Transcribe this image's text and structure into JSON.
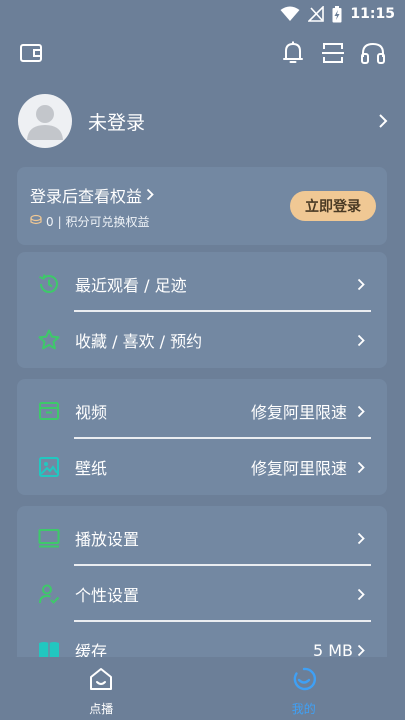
{
  "status_bar": {
    "time": "11:15"
  },
  "profile": {
    "name": "未登录"
  },
  "benefits": {
    "title": "登录后查看权益",
    "points": "0",
    "points_suffix": "| 积分可兑换权益",
    "login_button": "立即登录"
  },
  "history_section": {
    "items": [
      {
        "label": "最近观看 / 足迹",
        "icon": "history-clock-icon"
      },
      {
        "label": "收藏 / 喜欢 / 预约",
        "icon": "star-icon"
      }
    ]
  },
  "media_section": {
    "items": [
      {
        "label": "视频",
        "value": "修复阿里限速",
        "icon": "video-box-icon"
      },
      {
        "label": "壁纸",
        "value": "修复阿里限速",
        "icon": "image-icon"
      }
    ]
  },
  "settings_section": {
    "items": [
      {
        "label": "播放设置",
        "icon": "monitor-icon"
      },
      {
        "label": "个性设置",
        "icon": "user-check-icon"
      },
      {
        "label": "缓存",
        "value": "5 MB",
        "icon": "book-icon"
      }
    ]
  },
  "bottom_nav": {
    "items": [
      {
        "label": "点播",
        "icon": "home-icon"
      },
      {
        "label": "我的",
        "icon": "profile-tab-icon"
      }
    ]
  },
  "colors": {
    "background": "#6c7f98",
    "card": "#7388a2",
    "accent_green": "#3ec96a",
    "accent_cyan": "#22c7c0",
    "login_button": "#f0c894",
    "active_tab": "#3fa0f5"
  }
}
